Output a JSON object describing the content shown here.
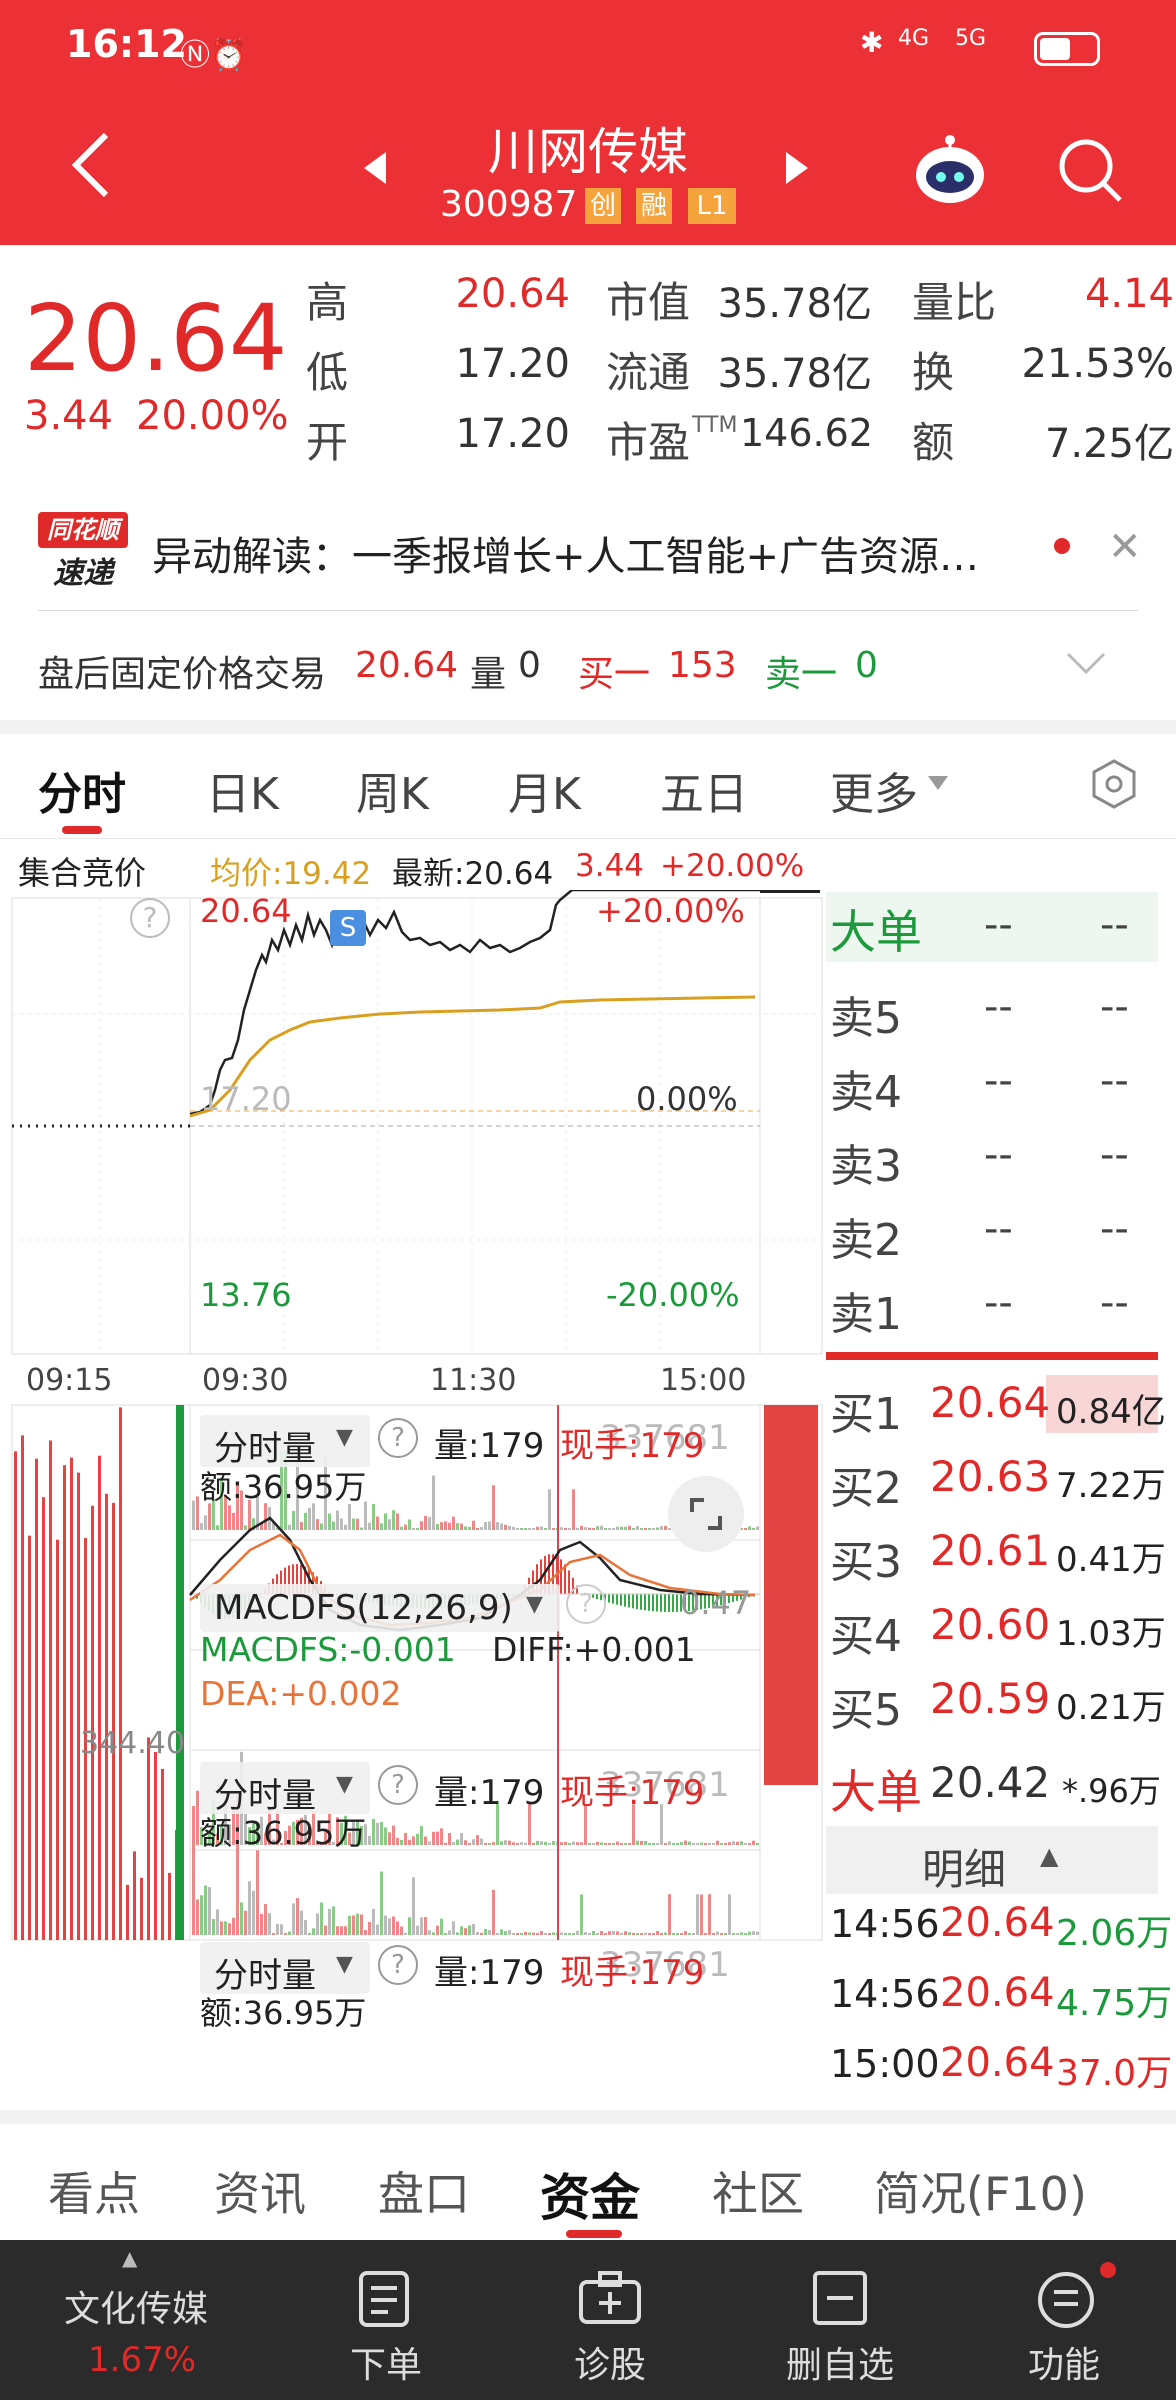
{
  "status": {
    "time": "16:12",
    "net1": "4G",
    "net2": "5G"
  },
  "header": {
    "name": "川网传媒",
    "code": "300987",
    "tag1": "创",
    "tag2": "融",
    "tag3": "L1"
  },
  "quote": {
    "price": "20.64",
    "chg": "3.44",
    "pct": "20.00%",
    "high_k": "高",
    "high": "20.64",
    "low_k": "低",
    "low": "17.20",
    "open_k": "开",
    "open": "17.20",
    "mcap_k": "市值",
    "mcap": "35.78亿",
    "float_k": "流通",
    "float": "35.78亿",
    "pe_k": "市盈",
    "pe_sup": "TTM",
    "pe": "146.62",
    "vr_k": "量比",
    "vr": "4.14",
    "turn_k": "换",
    "turn": "21.53%",
    "amt_k": "额",
    "amt": "7.25亿"
  },
  "news": {
    "logo1": "同花顺",
    "logo2": "速递",
    "text": "异动解读：一季报增长+人工智能+广告资源…"
  },
  "after": {
    "label": "盘后固定价格交易",
    "price": "20.64",
    "vol_k": "量",
    "vol": "0",
    "buy_k": "买一",
    "buy": "153",
    "sell_k": "卖一",
    "sell": "0"
  },
  "tabs": [
    "分时",
    "日K",
    "周K",
    "月K",
    "五日",
    "更多"
  ],
  "chart_info": {
    "auction": "集合竞价",
    "avg": "均价:19.42",
    "last": "最新:20.64",
    "chg": "3.44",
    "pct": "+20.00%",
    "hi": "20.64",
    "hi_pct": "+20.00%",
    "mid": "17.20",
    "mid_pct": "0.00%",
    "lo": "13.76",
    "lo_pct": "-20.00%",
    "t1": "09:15",
    "t2": "09:30",
    "t3": "11:30",
    "t4": "15:00",
    "s_badge": "S",
    "vol_scale": "344.40"
  },
  "panel1": {
    "name": "分时量",
    "vol": "量:179",
    "cur": "现手:179",
    "amt": "额:36.95万",
    "ghost": "337681"
  },
  "macd": {
    "name": "MACDFS(12,26,9)",
    "val": "0.47",
    "macd": "MACDFS:-0.001",
    "diff": "DIFF:+0.001",
    "dea": "DEA:+0.002"
  },
  "orderbook": {
    "big": "大单",
    "dash": "--",
    "sells": [
      "卖5",
      "卖4",
      "卖3",
      "卖2",
      "卖1"
    ],
    "buys": [
      {
        "k": "买1",
        "p": "20.64",
        "v": "0.84亿"
      },
      {
        "k": "买2",
        "p": "20.63",
        "v": "7.22万"
      },
      {
        "k": "买3",
        "p": "20.61",
        "v": "0.41万"
      },
      {
        "k": "买4",
        "p": "20.60",
        "v": "1.03万"
      },
      {
        "k": "买5",
        "p": "20.59",
        "v": "0.21万"
      }
    ],
    "big2": "大单",
    "big2_p": "20.42",
    "big2_v": "*.96万",
    "detail": "明细",
    "ticks": [
      {
        "t": "14:56",
        "p": "20.64",
        "v": "2.06万"
      },
      {
        "t": "14:56",
        "p": "20.64",
        "v": "4.75万"
      },
      {
        "t": "15:00",
        "p": "20.64",
        "v": "37.0万"
      }
    ]
  },
  "bottom_tabs": [
    "看点",
    "资讯",
    "盘口",
    "资金",
    "社区",
    "简况(F10)"
  ],
  "bar": {
    "sector": "文化传媒",
    "sector_pct": "1.67%",
    "order": "下单",
    "diag": "诊股",
    "remove": "删自选",
    "func": "功能"
  },
  "colors": {
    "red": "#ec3136",
    "green": "#1a9a3a",
    "avg_line": "#d9a020"
  }
}
